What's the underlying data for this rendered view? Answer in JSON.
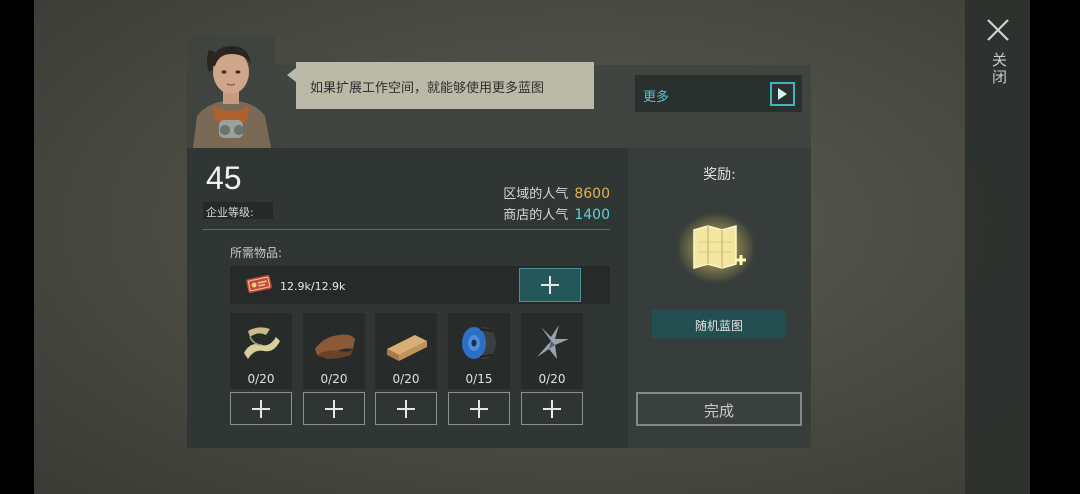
{
  "dialog": {
    "speech": "如果扩展工作空间，就能够使用更多蓝图",
    "more_label": "更多"
  },
  "close": {
    "label": "关闭"
  },
  "company": {
    "level_value": "45",
    "level_label": "企业等级:",
    "region_popularity_label": "区域的人气",
    "region_popularity_value": "8600",
    "shop_popularity_label": "商店的人气",
    "shop_popularity_value": "1400"
  },
  "requirements": {
    "label": "所需物品:",
    "ticket": {
      "icon": "ticket-icon",
      "amount": "12.9k/12.9k"
    },
    "items": [
      {
        "icon": "cloth-icon",
        "count": "0/20"
      },
      {
        "icon": "leather-icon",
        "count": "0/20"
      },
      {
        "icon": "wood-plank-icon",
        "count": "0/20"
      },
      {
        "icon": "wire-spool-icon",
        "count": "0/15"
      },
      {
        "icon": "metal-scrap-icon",
        "count": "0/20"
      }
    ]
  },
  "reward": {
    "title": "奖励:",
    "icon": "blueprint-map-icon",
    "name": "随机蓝图",
    "complete_label": "完成"
  },
  "colors": {
    "accent_teal": "#55c3cf",
    "gold": "#e3b24a",
    "popularity_blue": "#5fd1dc",
    "panel_dark": "#303634",
    "speech_bg": "#bbb9a7"
  }
}
